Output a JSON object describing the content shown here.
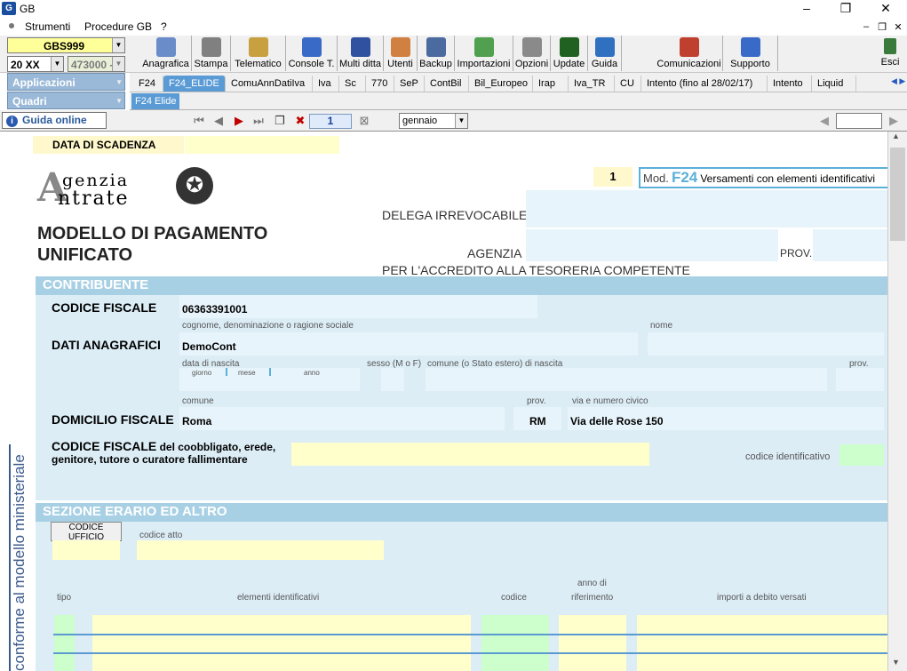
{
  "window": {
    "title": "GB",
    "logo": "G",
    "minimize": "–",
    "maximize": "❐",
    "close": "✕"
  },
  "menu": {
    "items": [
      "Strumenti",
      "Procedure GB",
      "?"
    ],
    "right_controls": [
      "–",
      "❐",
      "✕"
    ]
  },
  "left_panel": {
    "company_combo": "GBS999",
    "year_combo": "20 XX",
    "code_combo": "473000 -",
    "applicazioni_label": "Applicazioni",
    "quadri_label": "Quadri"
  },
  "toolbar": {
    "buttons": [
      {
        "label": "Anagrafica",
        "icon": "address-card-icon",
        "color": "#6a8cc8"
      },
      {
        "label": "Stampa",
        "icon": "printer-icon",
        "color": "#808080"
      },
      {
        "label": "Telematico",
        "icon": "document-icon",
        "color": "#c8a040"
      },
      {
        "label": "Console T.",
        "icon": "monitor-icon",
        "color": "#3a6ac8"
      },
      {
        "label": "Multi ditta",
        "icon": "m-icon",
        "color": "#3050a0"
      },
      {
        "label": "Utenti",
        "icon": "users-icon",
        "color": "#d08040"
      },
      {
        "label": "Backup",
        "icon": "server-icon",
        "color": "#4a6aa0"
      },
      {
        "label": "Importazioni",
        "icon": "download-icon",
        "color": "#50a050"
      },
      {
        "label": "Opzioni",
        "icon": "wrench-icon",
        "color": "#8a8a8a"
      },
      {
        "label": "Update",
        "icon": "pulse-icon",
        "color": "#206020"
      },
      {
        "label": "Guida",
        "icon": "help-icon",
        "color": "#3070c0"
      },
      {
        "label": "Comunicazioni",
        "icon": "megaphone-icon",
        "color": "#c04030"
      },
      {
        "label": "Supporto",
        "icon": "support-icon",
        "color": "#3a6ac8"
      }
    ],
    "exit_label": "Esci"
  },
  "tabs": [
    "F24",
    "F24_ELIDE",
    "ComuAnnDatiIva",
    "Iva",
    "Sc",
    "770",
    "SeP",
    "ContBil",
    "Bil_Europeo",
    "Irap",
    "Iva_TR",
    "CU",
    "Intento (fino al 28/02/17)",
    "Intento",
    "Liquid"
  ],
  "active_tab": "F24_ELIDE",
  "subtab": "F24 Elide",
  "nav": {
    "guida_online": "Guida online",
    "page": "1",
    "month": "gennaio"
  },
  "form": {
    "data_scadenza_label": "DATA DI SCADENZA",
    "logo_line1": "genzia",
    "logo_line2": "ntrate",
    "model_title_line1": "MODELLO DI PAGAMENTO",
    "model_title_line2": "UNIFICATO",
    "copy_number": "1",
    "mod_label": "Mod.",
    "mod_code": "F24",
    "mod_desc": "Versamenti con elementi identificativi",
    "delega_label": "DELEGA IRREVOCABILE A:",
    "agenzia_label": "AGENZIA",
    "prov_label": "PROV.",
    "accredito_label": "PER L'ACCREDITO ALLA TESORERIA COMPETENTE",
    "contribuente_band": "CONTRIBUENTE",
    "codice_fiscale_label": "CODICE FISCALE",
    "codice_fiscale_value": "06363391001",
    "cognome_hint": "cognome, denominazione o ragione sociale",
    "nome_hint": "nome",
    "dati_anagrafici_label": "DATI ANAGRAFICI",
    "cognome_value": "DemoCont",
    "data_nascita_hint": "data di nascita",
    "giorno_hint": "giorno",
    "mese_hint": "mese",
    "anno_hint": "anno",
    "sesso_hint": "sesso (M o F)",
    "comune_nascita_hint": "comune (o Stato estero) di nascita",
    "prov_hint": "prov.",
    "comune_hint": "comune",
    "prov2_hint": "prov.",
    "via_hint": "via e numero civico",
    "domicilio_label": "DOMICILIO FISCALE",
    "comune_value": "Roma",
    "prov_value": "RM",
    "via_value": "Via delle Rose 150",
    "coobbligato_label_bold": "CODICE FISCALE",
    "coobbligato_label_rest": "del coobbligato, erede,",
    "coobbligato_label_line2": "genitore, tutore o curatore fallimentare",
    "codice_identificativo_hint": "codice identificativo",
    "vertical_text": "conforme al modello ministeriale",
    "erario_band": "SEZIONE ERARIO ED ALTRO",
    "codice_ufficio_label": "CODICE UFFICIO",
    "codice_atto_hint": "codice atto",
    "tipo_hint": "tipo",
    "elementi_hint": "elementi identificativi",
    "codice_hint": "codice",
    "anno_rif_hint_1": "anno di",
    "anno_rif_hint_2": "riferimento",
    "importi_hint": "importi a debito versati"
  }
}
